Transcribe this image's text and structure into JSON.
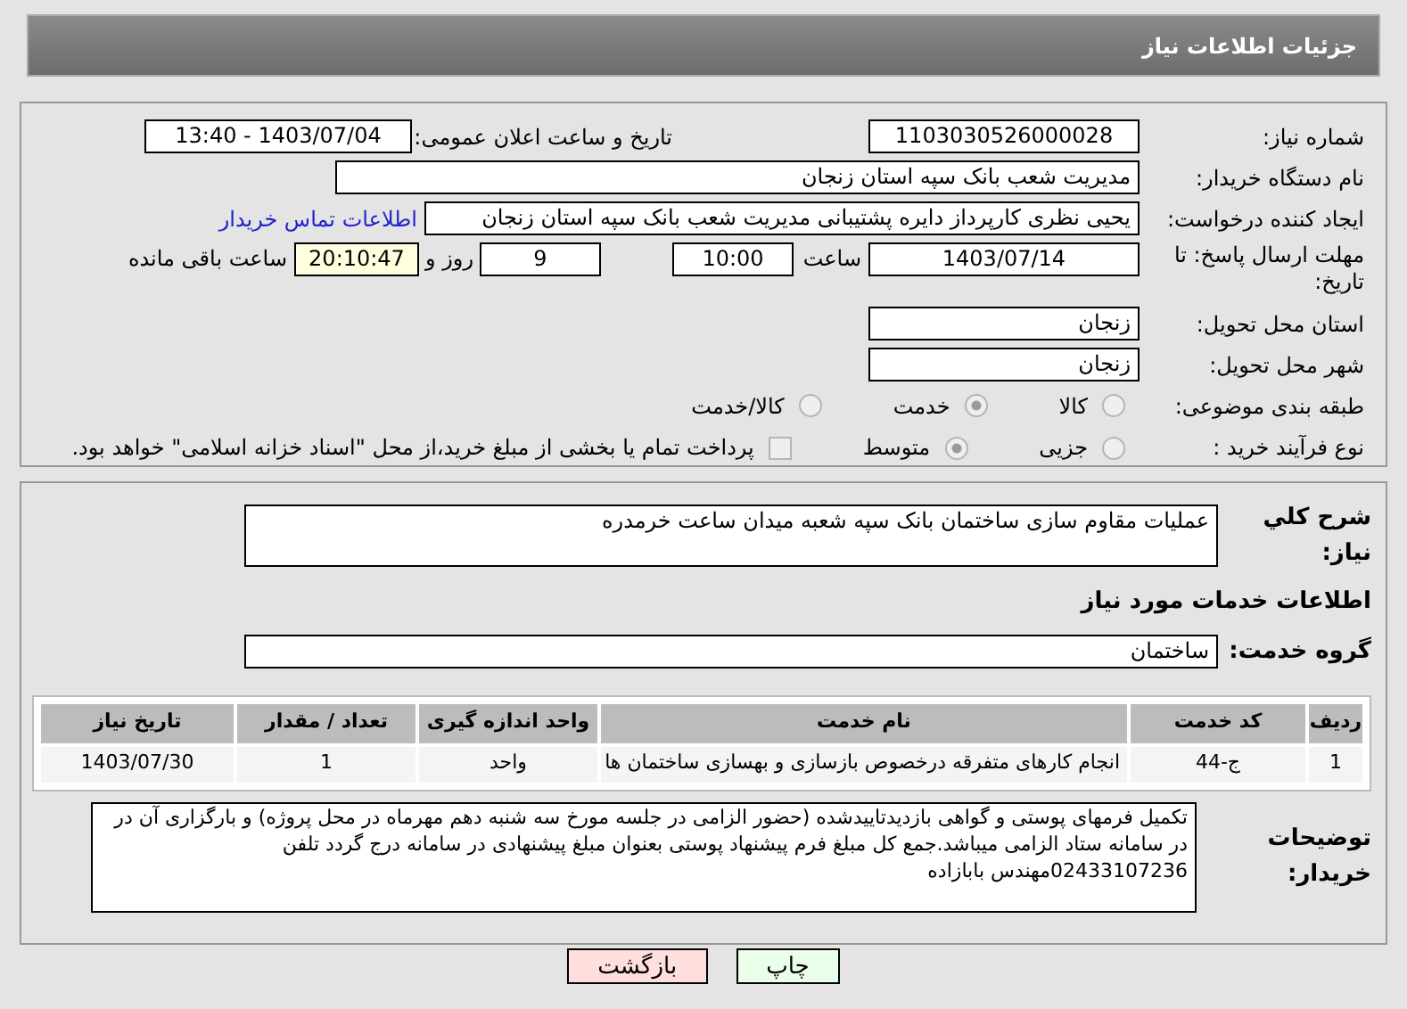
{
  "header": {
    "title": "جزئیات اطلاعات نیاز"
  },
  "need_number": {
    "label": "شماره نیاز:",
    "value": "1103030526000028"
  },
  "announce": {
    "label": "تاریخ و ساعت اعلان عمومی:",
    "value": "1403/07/04 - 13:40"
  },
  "buyer_org": {
    "label": "نام دستگاه خریدار:",
    "value": "مدیریت شعب بانک سپه استان زنجان"
  },
  "creator": {
    "label": "ایجاد کننده درخواست:",
    "value": "یحیی نظری کارپرداز دایره پشتیبانی  مدیریت شعب بانک سپه استان زنجان",
    "link": "اطلاعات تماس خریدار"
  },
  "deadline": {
    "label": "مهلت ارسال پاسخ: تا تاریخ:",
    "date": "1403/07/14",
    "time_label": "ساعت",
    "time": "10:00",
    "days": "9",
    "days_label": "روز و",
    "remaining": "20:10:47",
    "remaining_label": "ساعت باقی مانده"
  },
  "province": {
    "label": "استان محل تحویل:",
    "value": "زنجان"
  },
  "city": {
    "label": "شهر محل تحویل:",
    "value": "زنجان"
  },
  "category": {
    "label": "طبقه بندی موضوعی:",
    "options": [
      {
        "label": "کالا",
        "selected": false
      },
      {
        "label": "خدمت",
        "selected": true
      },
      {
        "label": "کالا/خدمت",
        "selected": false
      }
    ]
  },
  "process": {
    "label": "نوع فرآیند خرید :",
    "options": [
      {
        "label": "جزیی",
        "selected": false
      },
      {
        "label": "متوسط",
        "selected": true
      }
    ],
    "payment": {
      "label": "پرداخت تمام یا بخشی از مبلغ خرید،از محل \"اسناد خزانه اسلامی\" خواهد بود.",
      "checked": false
    }
  },
  "description": {
    "label": "شرح کلي نياز:",
    "value": "عملیات مقاوم سازی ساختمان بانک سپه شعبه میدان ساعت خرمدره"
  },
  "services_heading": "اطلاعات خدمات مورد نیاز",
  "service_group": {
    "label": "گروه خدمت:",
    "value": "ساختمان"
  },
  "table": {
    "columns": [
      "ردیف",
      "کد خدمت",
      "نام خدمت",
      "واحد اندازه گیری",
      "تعداد / مقدار",
      "تاریخ نیاز"
    ],
    "rows": [
      [
        "1",
        "ج-44",
        "انجام کارهای متفرقه درخصوص بازسازی و بهسازی ساختمان ها",
        "واحد",
        "1",
        "1403/07/30"
      ]
    ]
  },
  "buyer_notes": {
    "label": "توضیحات خریدار:",
    "value": "تکمیل فرمهای پوستی و گواهی بازدیدتاییدشده (حضور الزامی در جلسه مورخ سه شنبه دهم مهرماه در محل پروژه) و بارگزاری آن در در سامانه ستاد الزامی میباشد.جمع کل مبلغ فرم پیشنهاد پوستی بعنوان مبلغ پیشنهادی در سامانه درج گردد تلفن 02433107236مهندس بابازاده"
  },
  "buttons": [
    {
      "label": "چاپ",
      "kind": "print"
    },
    {
      "label": "بازگشت",
      "kind": "back"
    }
  ]
}
